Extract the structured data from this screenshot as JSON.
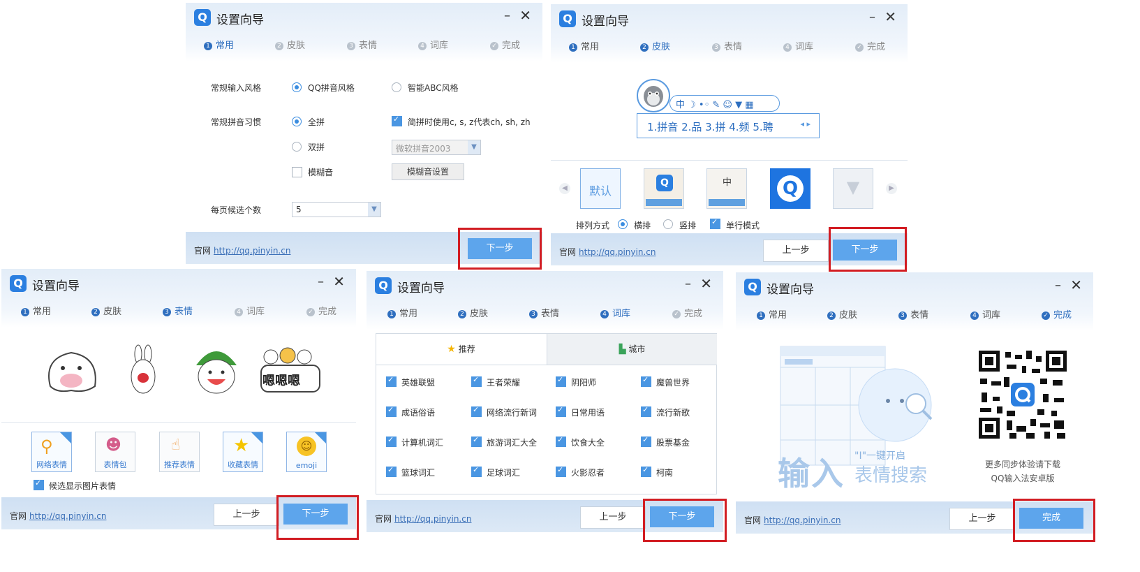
{
  "common": {
    "title": "设置向导",
    "logo": "Q",
    "minimize": "–",
    "close": "✕",
    "steps": [
      "常用",
      "皮肤",
      "表情",
      "词库",
      "完成"
    ],
    "site_label": "官网",
    "site_link": "http://qq.pinyin.cn",
    "prev_label": "上一步",
    "next_label": "下一步",
    "finish_label": "完成"
  },
  "window1": {
    "row1_label": "常规输入风格",
    "opt_qq": "QQ拼音风格",
    "opt_abc": "智能ABC风格",
    "row2_label": "常规拼音习惯",
    "opt_full": "全拼",
    "opt_jianpin": "简拼时使用c, s, z代表ch, sh, zh",
    "opt_double": "双拼",
    "double_scheme": "微软拼音2003",
    "opt_fuzzy": "模糊音",
    "fuzzy_settings": "模糊音设置",
    "row3_label": "每页候选个数",
    "per_page": "5"
  },
  "window2": {
    "toolbar_icons": "中 ☽ •◦ ✎ ☺ ▼ ▦",
    "candidates": "1.拼音 2.品 3.拼 4.频 5.聘",
    "skins": [
      "默认",
      "",
      "",
      "",
      ""
    ],
    "arrange_label": "排列方式",
    "opt_horizontal": "横排",
    "opt_vertical": "竖排",
    "opt_single": "单行模式"
  },
  "window3": {
    "emoji_sets": [
      "网络表情",
      "表情包",
      "推荐表情",
      "收藏表情",
      "emoji"
    ],
    "sticker_text": "嗯嗯嗯",
    "show_images": "候选显示图片表情"
  },
  "window4": {
    "tab_recommend": "推荐",
    "tab_city": "城市",
    "dicts": [
      [
        "英雄联盟",
        "王者荣耀",
        "阴阳师",
        "魔兽世界"
      ],
      [
        "成语俗语",
        "网络流行新词",
        "日常用语",
        "流行新歌"
      ],
      [
        "计算机词汇",
        "旅游词汇大全",
        "饮食大全",
        "股票基金"
      ],
      [
        "篮球词汇",
        "足球词汇",
        "火影忍者",
        "柯南"
      ]
    ]
  },
  "window5": {
    "promo_big": "输入",
    "promo_quote": "\"I\"一键开启",
    "promo_sub": "表情搜索",
    "qr_caption1": "更多同步体验请下载",
    "qr_caption2": "QQ输入法安卓版"
  },
  "colors": {
    "accent": "#2f6fbf",
    "button_blue": "#5da5ec",
    "highlight_red": "#d21d23",
    "footer_bg": "#d6e5f5"
  }
}
